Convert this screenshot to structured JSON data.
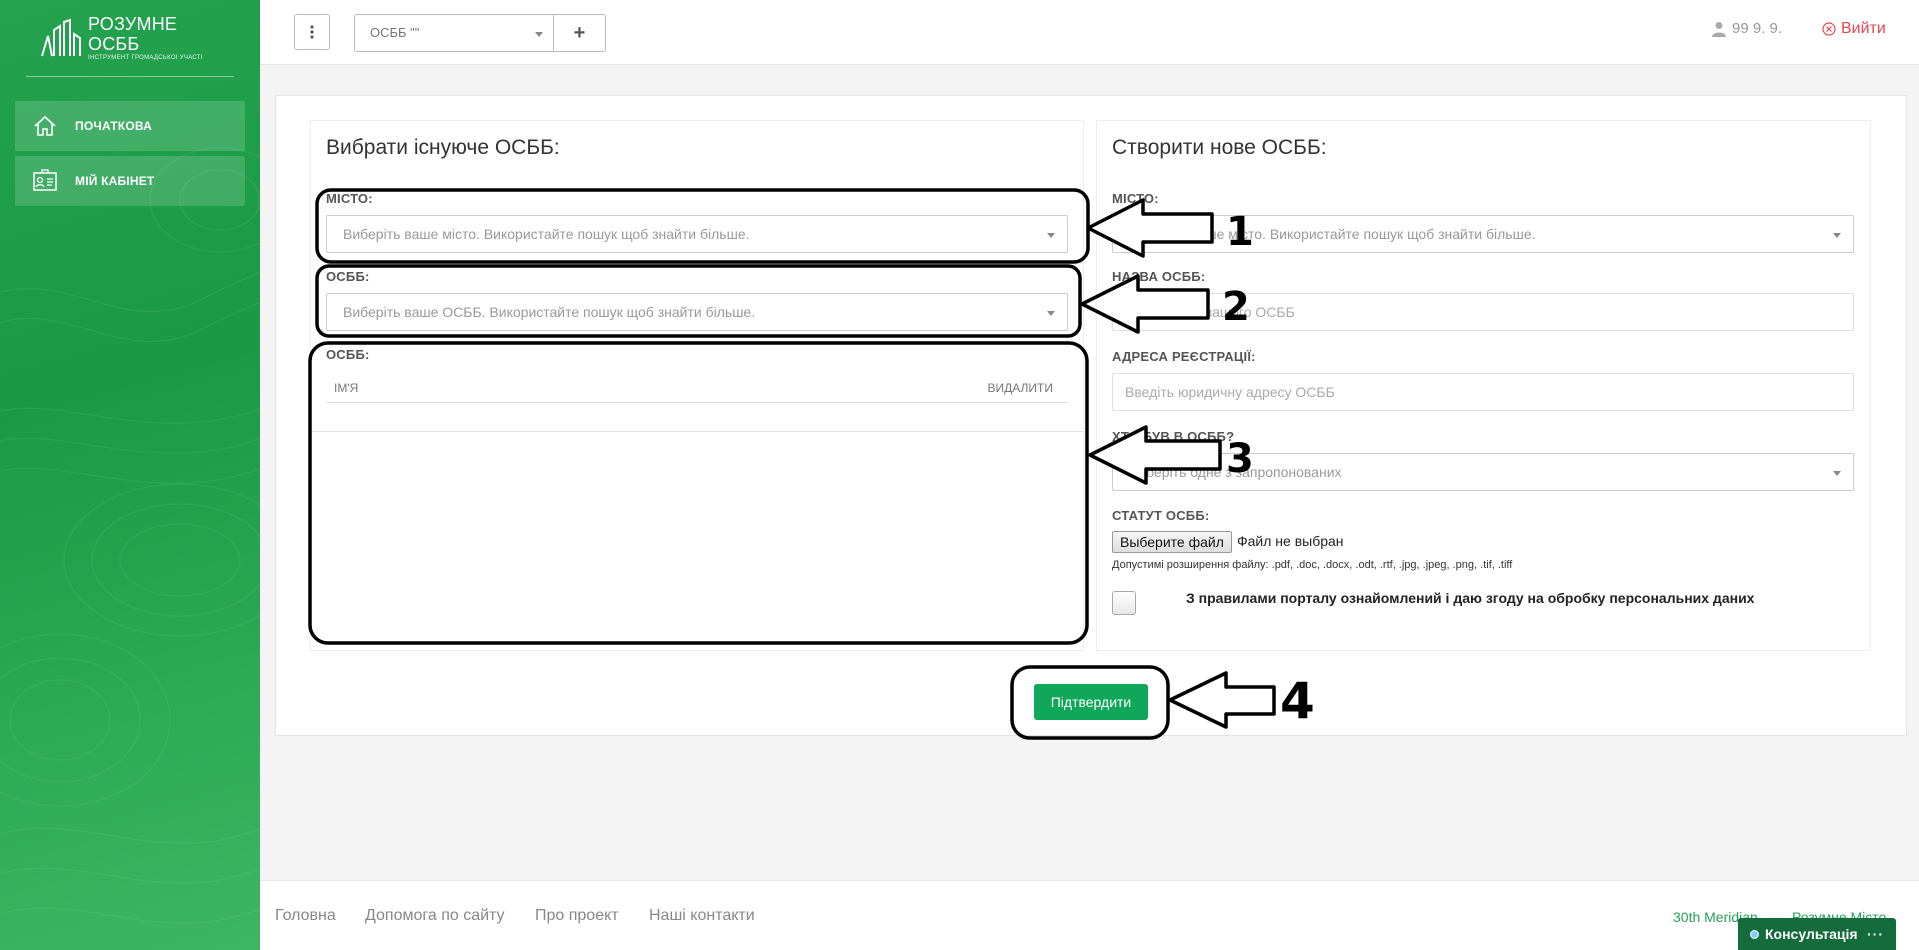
{
  "brand": {
    "title": "РОЗУМНЕ ОСББ",
    "subtitle": "ІНСТРУМЕНТ ГРОМАДСЬКОЇ УЧАСТІ"
  },
  "sidebar": {
    "items": [
      {
        "label": "ПОЧАТКОВА",
        "icon": "home-icon"
      },
      {
        "label": "МІЙ КАБІНЕТ",
        "icon": "id-card-icon"
      }
    ]
  },
  "topbar": {
    "osbb_select_value": "ОСББ \"\"",
    "add_label": "+",
    "user_name": "99 9. 9.",
    "logout_label": "Вийти"
  },
  "left_panel": {
    "title": "Вибрати існуюче ОСББ:",
    "city_label": "МІСТО:",
    "city_placeholder": "Виберіть ваше місто. Використайте пошук щоб знайти більше.",
    "osbb_label": "ОСББ:",
    "osbb_placeholder": "Виберіть ваше ОСББ. Використайте пошук щоб знайти більше.",
    "table_label": "ОСББ:",
    "table_headers": {
      "name": "ІМ'Я",
      "delete": "ВИДАЛИТИ"
    }
  },
  "right_panel": {
    "title": "Створити нове ОСББ:",
    "city_label": "МІСТО:",
    "city_placeholder": "Виберіть ваше місто. Використайте пошук щоб знайти більше.",
    "name_label": "НАЗВА ОСББ:",
    "name_placeholder": "Введіть ім'я вашого ОСББ",
    "address_label": "АДРЕСА РЕЄСТРАЦІЇ:",
    "address_placeholder": "Введіть юридичну адресу ОСББ",
    "creator_label": "ХТО БУВ В ОСББ?",
    "creator_placeholder": "Виберіть одне з запропонованих",
    "statute_label": "СТАТУТ ОСББ:",
    "file_button": "Выберите файл",
    "file_status": "Файл не выбран",
    "file_hint": "Допустимі розширення файлу: .pdf, .doc, .docx, .odt, .rtf, .jpg, .jpeg, .png, .tif, .tiff",
    "agree_text": "З правилами порталу ознайомлений і даю згоду на обробку персональних даних"
  },
  "submit_label": "Підтвердити",
  "annotations": [
    "1",
    "2",
    "3",
    "4"
  ],
  "footer": {
    "links": [
      "Головна",
      "Допомога по сайту",
      "Про проект",
      "Наші контакти"
    ],
    "right_links": [
      "30th Meridian",
      "Розумне Місто"
    ],
    "chat_label": "Консультація",
    "chat_more": "···"
  },
  "colors": {
    "brand_green": "#1a9a45",
    "button_green": "#0fa75a",
    "logout_red": "#e5484d"
  }
}
